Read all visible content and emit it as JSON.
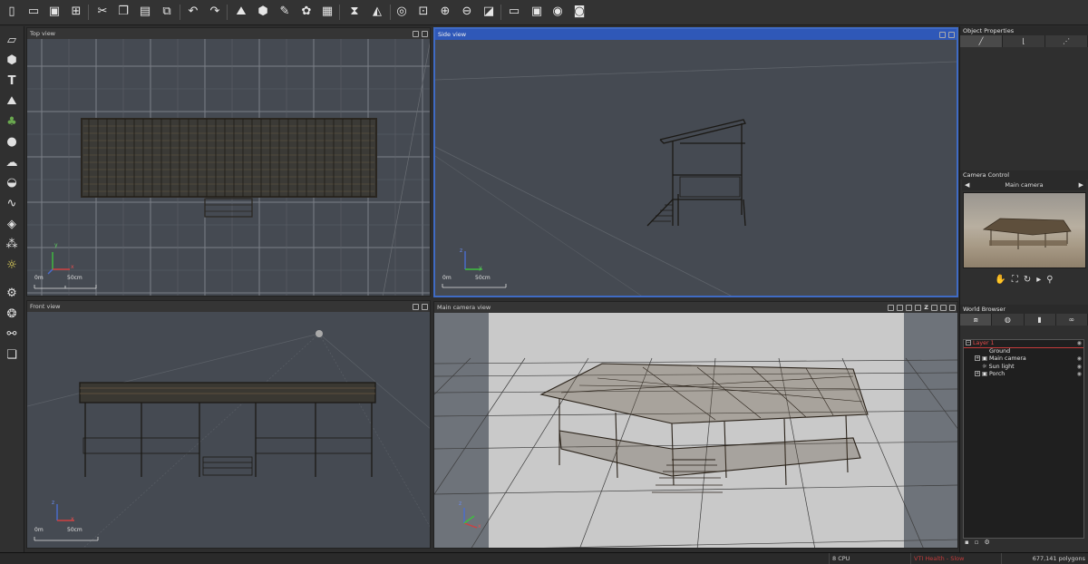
{
  "toolbar": {
    "icons": [
      "new-file",
      "open-file",
      "save-file",
      "import",
      "cut",
      "copy",
      "paste",
      "duplicate",
      "undo",
      "redo",
      "terrain",
      "box",
      "paint",
      "color-palette",
      "clapperboard",
      "mirror",
      "flip",
      "globe",
      "grid",
      "zoom-in",
      "zoom-out",
      "fit",
      "fullscreen-1",
      "fullscreen-2",
      "render",
      "camera"
    ]
  },
  "left_tools": {
    "icons": [
      "plane",
      "cube",
      "text",
      "terrain",
      "tree",
      "sphere",
      "cloud",
      "planet",
      "curve",
      "object",
      "particles",
      "light",
      "gear",
      "cluster",
      "link",
      "layers"
    ]
  },
  "viewports": {
    "top": {
      "title": "Top view",
      "scale_start": "0m",
      "scale_end": "50cm",
      "axis_1": "y",
      "axis_2": "x"
    },
    "side": {
      "title": "Side view",
      "scale_start": "0m",
      "scale_end": "50cm",
      "axis_1": "z",
      "axis_2": "y"
    },
    "front": {
      "title": "Front view",
      "scale_start": "0m",
      "scale_end": "50cm",
      "axis_1": "z",
      "axis_2": "x"
    },
    "camera": {
      "title": "Main camera view",
      "axis_1": "z",
      "axis_2": "x",
      "header_z": "Z"
    }
  },
  "object_properties": {
    "title": "Object Properties"
  },
  "camera_control": {
    "title": "Camera Control",
    "camera_name": "Main camera",
    "prev": "◀",
    "next": "▶"
  },
  "world_browser": {
    "title": "World Browser",
    "tree": [
      {
        "label": "Layer 1",
        "expander": "−",
        "indent": 0,
        "selected": true
      },
      {
        "label": "Ground",
        "expander": "",
        "indent": 2,
        "selected": false
      },
      {
        "label": "Main camera",
        "expander": "+",
        "indent": 1,
        "selected": false
      },
      {
        "label": "Sun light",
        "expander": "",
        "indent": 1,
        "selected": false
      },
      {
        "label": "Porch",
        "expander": "+",
        "indent": 1,
        "selected": false
      }
    ]
  },
  "status": {
    "cpu": "8 CPU",
    "alert": "VTI Health - Slow",
    "polygons": "677,141 polygons"
  },
  "colors": {
    "accent": "#3f6bc4",
    "viewport_bg": "#454a52",
    "camera_bg": "#c8c8c8",
    "alert": "#c43b3b"
  }
}
